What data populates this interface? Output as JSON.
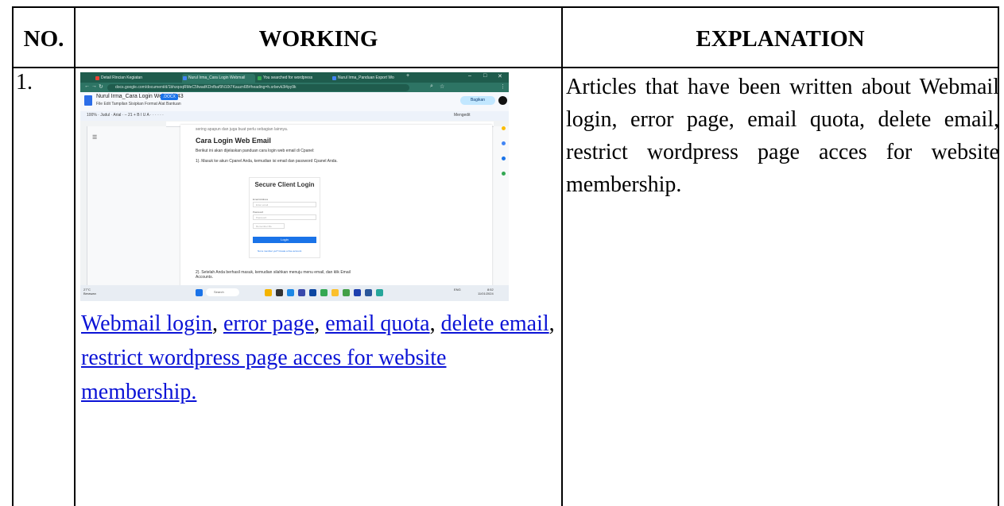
{
  "table": {
    "headers": {
      "no": "NO.",
      "working": "WORKING",
      "explanation": "EXPLANATION"
    },
    "row": {
      "no": "1.",
      "links": [
        {
          "text": "Webmail login",
          "sep": ", "
        },
        {
          "text": "error page",
          "sep": ", "
        },
        {
          "text": "email quota",
          "sep": ", "
        },
        {
          "text": "delete email",
          "sep": ", "
        },
        {
          "text": "restrict wordpress page acces for website membership.",
          "sep": ""
        }
      ],
      "explanation": "Articles that have been written about Webmail login, error page, email quota, delete email, restrict wordpress page acces for website membership."
    }
  },
  "screenshot": {
    "tabs": [
      {
        "label": "Detail Rincian Kegiatan",
        "color": "#ea4335"
      },
      {
        "label": "Nurul Irma_Cara Login Webmail",
        "color": "#4285f4"
      },
      {
        "label": "You searched for wordpress",
        "color": "#34a853"
      },
      {
        "label": "Nurul Irma_Panduan Export Wo",
        "color": "#4285f4"
      }
    ],
    "url": "docs.google.com/document/d/1bhzqoqRMeC5fwadKDnfbaf9N10t7Kauzn6B#heading=h.srbevk3l4py9k",
    "doc_title": "Nurul Irma_Cara Login Webmail.43",
    "doc_badge": ".DOCX",
    "menus": "File   Edit   Tampilan   Sisipkan   Format   Alat   Bantuan",
    "toolbar_text": "100%  ·  Judul  ·  Arial  ·  – 21 +   B  I  U  A   ·   ·   ·   ·   ·   ·",
    "editing_mode": "Mengedit",
    "share_label": "Bagikan",
    "doc_body": {
      "faded_line": "sering apapun dan juga buat perlu sebagian lainnya.",
      "heading": "Cara Login Web Email",
      "line1": "Berikut ini akan dijelaskan panduan cara login web email di Cpanel:",
      "line2": "1). Masuk ke akun Cpanel Anda, kemudian isi email dan password Cpanel Anda.",
      "card_title": "Secure Client Login",
      "card_email_label": "Email Address",
      "card_email_ph": "Enter email",
      "card_pass_label": "Password",
      "card_pass_ph": "Password",
      "card_remember": "Remember Me",
      "card_button": "Login",
      "card_forgot": "Not a member yet? Create a free account",
      "line3": "2). Setelah Anda berhasil masuk, kemudian silahkan menuju menu email, dan klik Email Accounts."
    },
    "taskbar": {
      "weather_temp": "27°C",
      "weather_desc": "Berawan",
      "search": "Search",
      "time": "8:52",
      "date": "11/01/2024",
      "lang": "ENG"
    }
  }
}
